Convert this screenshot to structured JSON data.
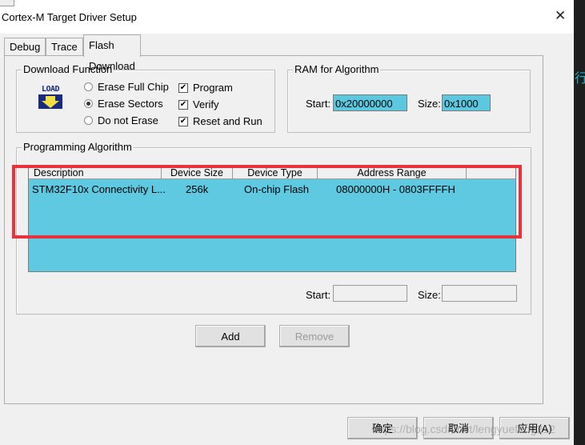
{
  "window": {
    "title": "Cortex-M Target Driver Setup"
  },
  "tabs": [
    {
      "label": "Debug"
    },
    {
      "label": "Trace"
    },
    {
      "label": "Flash Download"
    }
  ],
  "download_function": {
    "title": "Download Function",
    "icon_text": "LOAD",
    "erase_options": [
      {
        "label": "Erase Full Chip",
        "selected": false
      },
      {
        "label": "Erase Sectors",
        "selected": true
      },
      {
        "label": "Do not Erase",
        "selected": false
      }
    ],
    "checks": [
      {
        "label": "Program",
        "checked": true
      },
      {
        "label": "Verify",
        "checked": true
      },
      {
        "label": "Reset and Run",
        "checked": true
      }
    ]
  },
  "ram_for_algorithm": {
    "title": "RAM for Algorithm",
    "start_label": "Start:",
    "start_value": "0x20000000",
    "size_label": "Size:",
    "size_value": "0x1000"
  },
  "programming_algorithm": {
    "title": "Programming Algorithm",
    "columns": [
      "Description",
      "Device Size",
      "Device Type",
      "Address Range"
    ],
    "rows": [
      {
        "description": "STM32F10x Connectivity L...",
        "device_size": "256k",
        "device_type": "On-chip Flash",
        "address_range": "08000000H - 0803FFFFH"
      }
    ],
    "start_label": "Start:",
    "start_value": "",
    "size_label": "Size:",
    "size_value": ""
  },
  "buttons": {
    "add": "Add",
    "remove": "Remove",
    "ok": "确定",
    "cancel": "取消",
    "apply": "应用(A)"
  },
  "right_glyph": "行",
  "watermark": "https://blog.csdn.net/lengyuefeng212",
  "colors": {
    "highlight": "#5ec9e0",
    "annotation": "#e8323c"
  }
}
